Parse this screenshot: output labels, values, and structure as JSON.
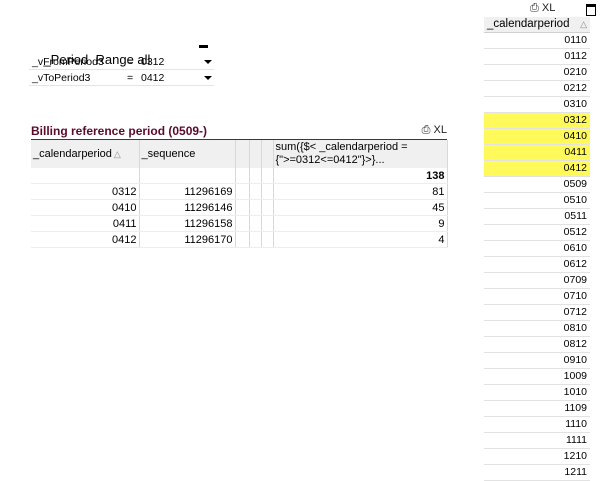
{
  "period_box": {
    "title": "_Period  Range all",
    "variables": [
      {
        "name": "_vFromPeriod3",
        "op": "=",
        "value": "0312"
      },
      {
        "name": "_vToPeriod3",
        "op": "=",
        "value": "0412"
      }
    ]
  },
  "billing": {
    "title": "Billing reference period  (0509-)",
    "icons_label": "XL",
    "columns": [
      "_calendarperiod",
      "_sequence",
      "",
      "",
      "",
      "sum({$< _calendarperiod = {\">=0312<=0412\"}>}..."
    ],
    "total_row": [
      "",
      "",
      "",
      "",
      "",
      "138"
    ],
    "rows": [
      [
        "0312",
        "11296169",
        "",
        "",
        "",
        "81"
      ],
      [
        "0410",
        "11296146",
        "",
        "",
        "",
        "45"
      ],
      [
        "0411",
        "11296158",
        "",
        "",
        "",
        "9"
      ],
      [
        "0412",
        "11296170",
        "",
        "",
        "",
        "4"
      ]
    ],
    "sort_indicator": "△"
  },
  "listbox": {
    "icons_label": "XL",
    "header": "_calendarperiod",
    "sort_indicator": "△",
    "items": [
      {
        "value": "0110",
        "selected": false
      },
      {
        "value": "0112",
        "selected": false
      },
      {
        "value": "0210",
        "selected": false
      },
      {
        "value": "0212",
        "selected": false
      },
      {
        "value": "0310",
        "selected": false
      },
      {
        "value": "0312",
        "selected": true
      },
      {
        "value": "0410",
        "selected": true
      },
      {
        "value": "0411",
        "selected": true
      },
      {
        "value": "0412",
        "selected": true
      },
      {
        "value": "0509",
        "selected": false
      },
      {
        "value": "0510",
        "selected": false
      },
      {
        "value": "0511",
        "selected": false
      },
      {
        "value": "0512",
        "selected": false
      },
      {
        "value": "0610",
        "selected": false
      },
      {
        "value": "0612",
        "selected": false
      },
      {
        "value": "0709",
        "selected": false
      },
      {
        "value": "0710",
        "selected": false
      },
      {
        "value": "0712",
        "selected": false
      },
      {
        "value": "0810",
        "selected": false
      },
      {
        "value": "0812",
        "selected": false
      },
      {
        "value": "0910",
        "selected": false
      },
      {
        "value": "1009",
        "selected": false
      },
      {
        "value": "1010",
        "selected": false
      },
      {
        "value": "1109",
        "selected": false
      },
      {
        "value": "1110",
        "selected": false
      },
      {
        "value": "1111",
        "selected": false
      },
      {
        "value": "1210",
        "selected": false
      },
      {
        "value": "1211",
        "selected": false
      }
    ],
    "selected_color": "#fff95a"
  }
}
